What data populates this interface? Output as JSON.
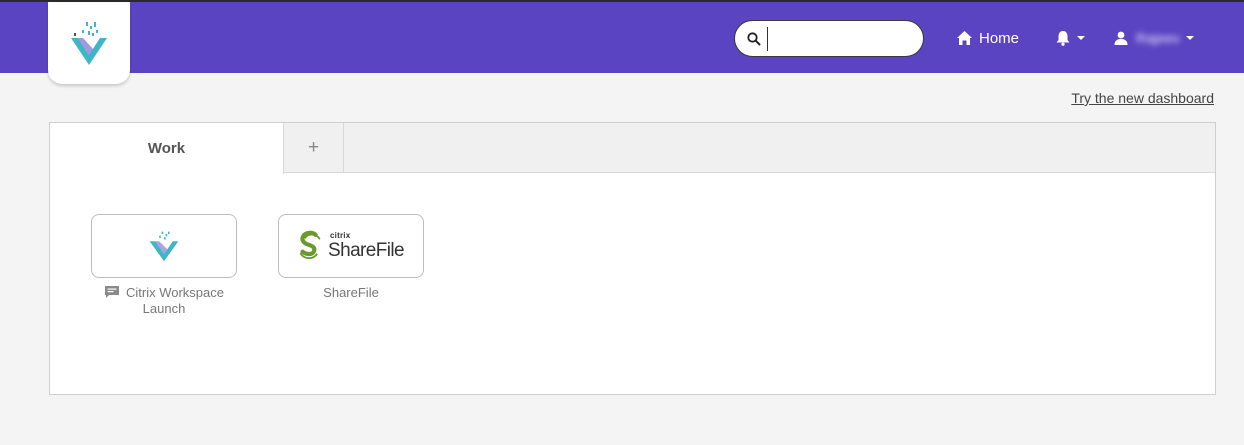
{
  "header": {
    "logo_icon": "citrix-workspace-logo",
    "search": {
      "value": "",
      "placeholder": ""
    },
    "home_label": "Home",
    "user_name": "Rajeev"
  },
  "links": {
    "try_new_dashboard": "Try the new dashboard"
  },
  "tabs": [
    {
      "label": "Work",
      "active": true
    },
    {
      "label": "+"
    }
  ],
  "apps": [
    {
      "label_line1": "Citrix Workspace",
      "label_line2": "Launch",
      "icon": "citrix-workspace-icon"
    },
    {
      "label": "ShareFile",
      "brand_small": "citrix",
      "brand_name": "ShareFile",
      "icon": "sharefile-icon"
    }
  ],
  "colors": {
    "header_bg": "#5b44c2",
    "page_bg": "#f4f4f4",
    "sharefile_green": "#6a9a2a",
    "logo_teal": "#3fb6c8"
  }
}
